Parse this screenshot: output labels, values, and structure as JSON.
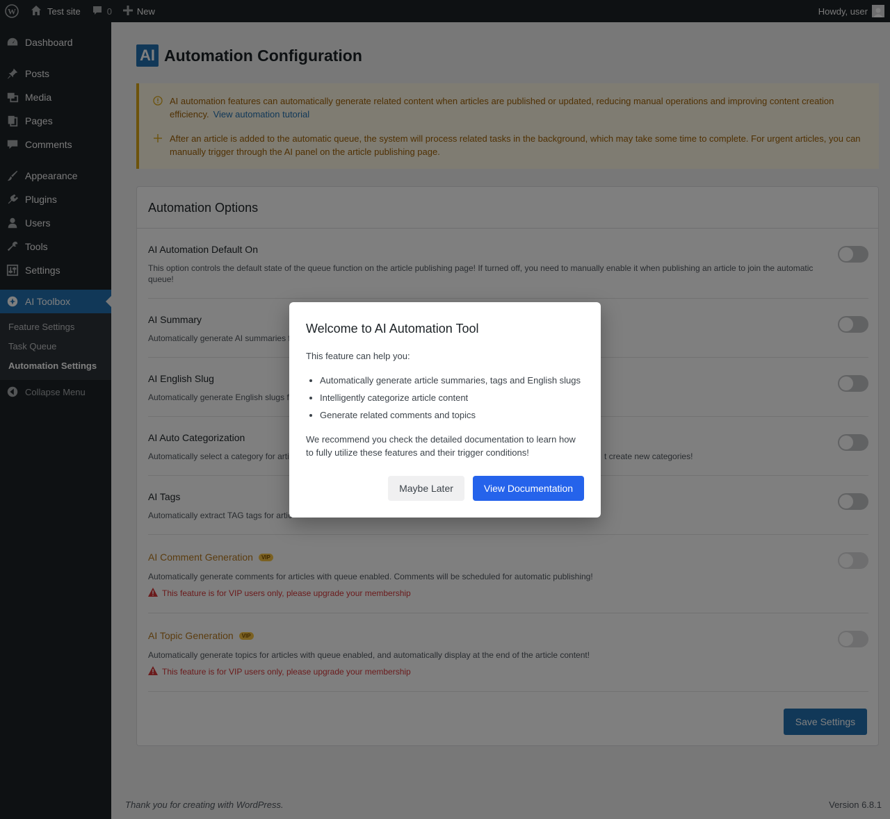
{
  "admin_bar": {
    "site_name": "Test site",
    "comments_count": "0",
    "new_label": "New",
    "howdy": "Howdy, user"
  },
  "sidebar": {
    "items": [
      {
        "label": "Dashboard",
        "icon": "dashboard-icon"
      },
      {
        "label": "Posts",
        "icon": "pin-icon"
      },
      {
        "label": "Media",
        "icon": "media-icon"
      },
      {
        "label": "Pages",
        "icon": "pages-icon"
      },
      {
        "label": "Comments",
        "icon": "comment-icon"
      },
      {
        "label": "Appearance",
        "icon": "brush-icon"
      },
      {
        "label": "Plugins",
        "icon": "plug-icon"
      },
      {
        "label": "Users",
        "icon": "user-icon"
      },
      {
        "label": "Tools",
        "icon": "wrench-icon"
      },
      {
        "label": "Settings",
        "icon": "settings-sliders-icon"
      },
      {
        "label": "AI Toolbox",
        "icon": "ai-toolbox-icon"
      }
    ],
    "submenu": [
      "Feature Settings",
      "Task Queue",
      "Automation Settings"
    ],
    "collapse_label": "Collapse Menu"
  },
  "page": {
    "logo_text": "AI",
    "title": "Automation Configuration"
  },
  "notice": {
    "line1": "AI automation features can automatically generate related content when articles are published or updated, reducing manual operations and improving content creation efficiency.",
    "link": "View automation tutorial",
    "line2": "After an article is added to the automatic queue, the system will process related tasks in the background, which may take some time to complete. For urgent articles, you can manually trigger through the AI panel on the article publishing page."
  },
  "options": {
    "title": "Automation Options",
    "items": [
      {
        "title": "AI Automation Default On",
        "desc": "This option controls the default state of the queue function on the article publishing page! If turned off, you need to manually enable it when publishing an article to join the automatic queue!",
        "enabled": false
      },
      {
        "title": "AI Summary",
        "desc": "Automatically generate AI summaries f",
        "enabled": false
      },
      {
        "title": "AI English Slug",
        "desc": "Automatically generate English slugs fo",
        "enabled": false
      },
      {
        "title": "AI Auto Categorization",
        "desc": "Automatically select a category for artic",
        "desc_tail": "t create new categories!",
        "enabled": false
      },
      {
        "title": "AI Tags",
        "desc": "Automatically extract TAG tags for artic",
        "enabled": false
      },
      {
        "title": "AI Comment Generation",
        "badge": "VIP",
        "desc": "Automatically generate comments for articles with queue enabled. Comments will be scheduled for automatic publishing!",
        "warning": "This feature is for VIP users only, please upgrade your membership",
        "enabled": false
      },
      {
        "title": "AI Topic Generation",
        "badge": "VIP",
        "desc": "Automatically generate topics for articles with queue enabled, and automatically display at the end of the article content!",
        "warning": "This feature is for VIP users only, please upgrade your membership",
        "enabled": false
      }
    ],
    "save_label": "Save Settings"
  },
  "footer": {
    "thanks": "Thank you for creating with WordPress.",
    "version": "Version 6.8.1"
  },
  "modal": {
    "title": "Welcome to AI Automation Tool",
    "intro": "This feature can help you:",
    "bullets": [
      "Automatically generate article summaries, tags and English slugs",
      "Intelligently categorize article content",
      "Generate related comments and topics"
    ],
    "recommend": "We recommend you check the detailed documentation to learn how to fully utilize these features and their trigger conditions!",
    "later_label": "Maybe Later",
    "docs_label": "View Documentation"
  },
  "colors": {
    "accent": "#2271b1",
    "modal_primary": "#2563eb",
    "warning": "#d63638",
    "vip": "#b7791f"
  }
}
